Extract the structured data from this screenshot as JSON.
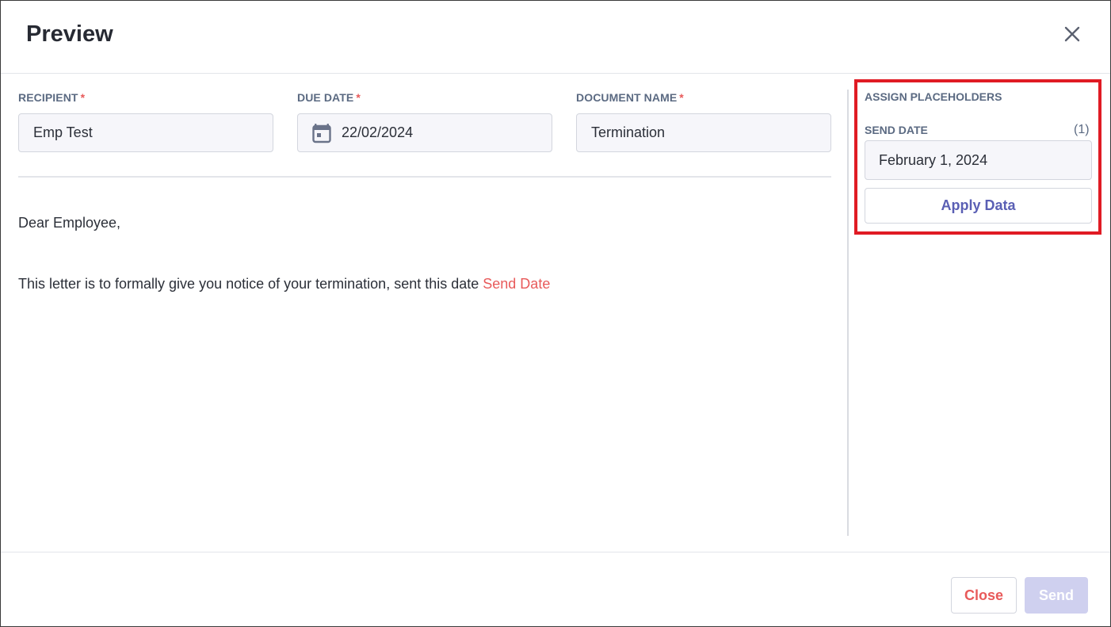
{
  "modal": {
    "title": "Preview",
    "close_icon": "close-icon"
  },
  "form": {
    "recipient": {
      "label": "RECIPIENT",
      "required_mark": "*",
      "value": "Emp Test"
    },
    "due_date": {
      "label": "DUE DATE",
      "required_mark": "*",
      "value": "22/02/2024",
      "icon": "calendar-icon"
    },
    "document_name": {
      "label": "DOCUMENT NAME",
      "required_mark": "*",
      "value": "Termination"
    }
  },
  "letter": {
    "greeting": "Dear Employee,",
    "body": "This letter is to formally give you notice of your termination, sent this date ",
    "placeholder": "Send Date"
  },
  "placeholders": {
    "title": "ASSIGN PLACEHOLDERS",
    "send_date": {
      "label": "SEND DATE",
      "count": "(1)",
      "value": "February 1, 2024"
    },
    "apply_label": "Apply Data"
  },
  "footer": {
    "close_label": "Close",
    "send_label": "Send"
  },
  "colors": {
    "accent": "#5a5fb4",
    "required": "#e85a5a",
    "highlight": "#e01b24",
    "send_disabled": "#cfd0ef"
  }
}
